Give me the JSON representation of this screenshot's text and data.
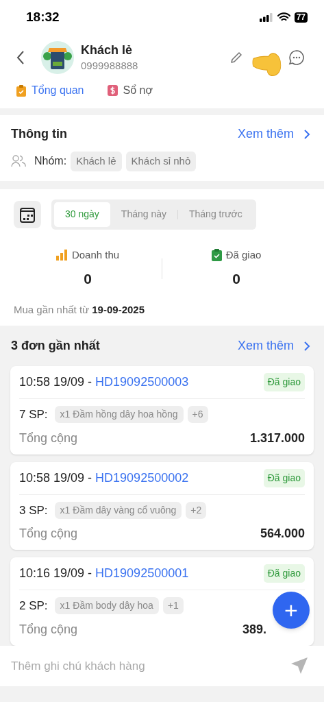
{
  "status_bar": {
    "time": "18:32",
    "battery": "77"
  },
  "header": {
    "name": "Khách lẻ",
    "phone": "0999988888"
  },
  "tabs": [
    {
      "label": "Tổng quan",
      "selected": true
    },
    {
      "label": "Sổ nợ",
      "selected": false
    }
  ],
  "info": {
    "title": "Thông tin",
    "more": "Xem thêm",
    "group_label": "Nhóm:",
    "groups": [
      "Khách lẻ",
      "Khách sỉ nhỏ"
    ]
  },
  "periods": [
    {
      "label": "30 ngày",
      "selected": true
    },
    {
      "label": "Tháng này",
      "selected": false
    },
    {
      "label": "Tháng trước",
      "selected": false
    }
  ],
  "stats": [
    {
      "kind": "revenue",
      "label": "Doanh thu",
      "value": "0"
    },
    {
      "kind": "delivered",
      "label": "Đã giao",
      "value": "0"
    }
  ],
  "last_purchase": "Mua gần nhất từ **19-09-2025**",
  "orders_section": {
    "title": "3 đơn gần nhất",
    "more": "Xem thêm"
  },
  "orders": [
    {
      "time": "10:58 19/09 -",
      "code": "HD19092500003",
      "status": "Đã giao",
      "count": "7 SP:",
      "item": "x1 Đầm hồng dây hoa hồng",
      "extra": "+6",
      "total_label": "Tổng cộng",
      "total": "1.317.000"
    },
    {
      "time": "10:58 19/09 -",
      "code": "HD19092500002",
      "status": "Đã giao",
      "count": "3 SP:",
      "item": "x1 Đầm dây vàng cổ vuông",
      "extra": "+2",
      "total_label": "Tổng cộng",
      "total": "564.000"
    },
    {
      "time": "10:16 19/09 -",
      "code": "HD19092500001",
      "status": "Đã giao",
      "count": "2 SP:",
      "item": "x1 Đầm body dây hoa",
      "extra": "+1",
      "total_label": "Tổng cộng",
      "total": "389."
    }
  ],
  "fab": "+",
  "note": {
    "placeholder": "Thêm ghi chú khách hàng"
  }
}
